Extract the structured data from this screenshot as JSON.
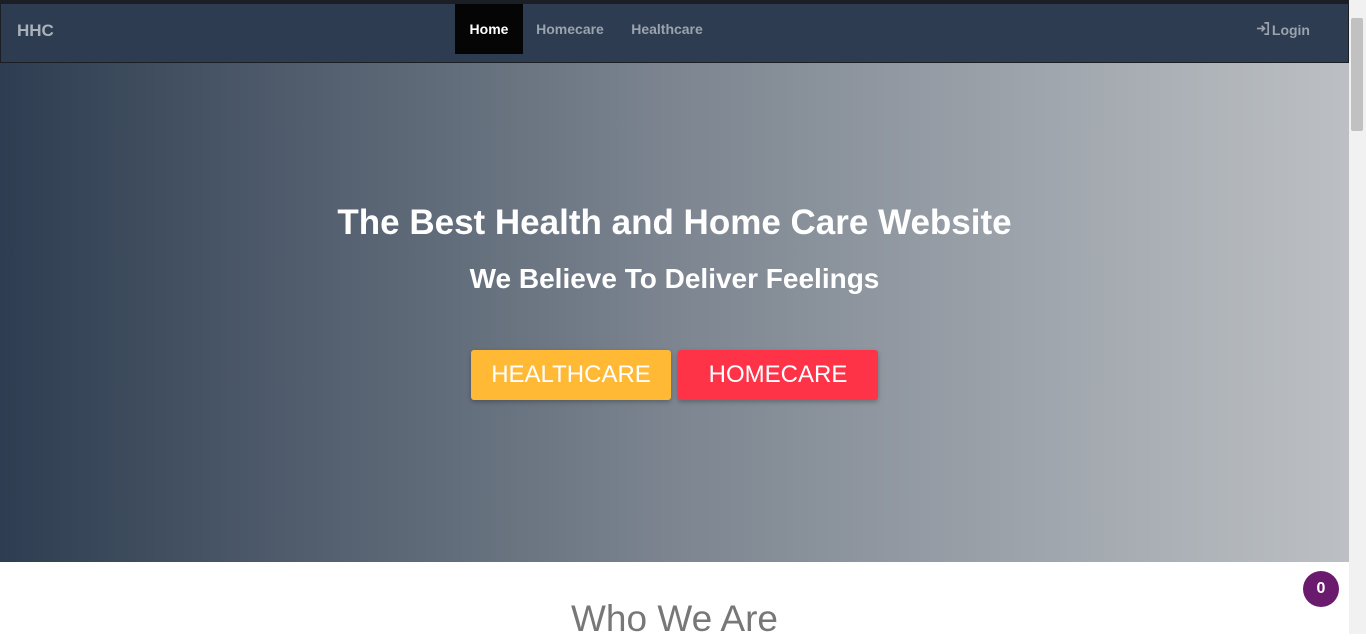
{
  "navbar": {
    "brand": "HHC",
    "items": [
      {
        "label": "Home",
        "active": true
      },
      {
        "label": "Homecare",
        "active": false
      },
      {
        "label": "Healthcare",
        "active": false
      }
    ],
    "login_label": "Login",
    "login_icon": "login-icon"
  },
  "hero": {
    "title": "The Best Health and Home Care Website",
    "subtitle": "We Believe To Deliver Feelings",
    "buttons": {
      "healthcare": "HEALTHCARE",
      "homecare": "HOMECARE"
    }
  },
  "section": {
    "heading": "Who We Are"
  },
  "cart_badge": {
    "count": "0"
  },
  "colors": {
    "navbar_bg": "#2d3c50",
    "healthcare_btn": "#ffb935",
    "homecare_btn": "#ff3347",
    "badge": "#6a1b6e"
  }
}
